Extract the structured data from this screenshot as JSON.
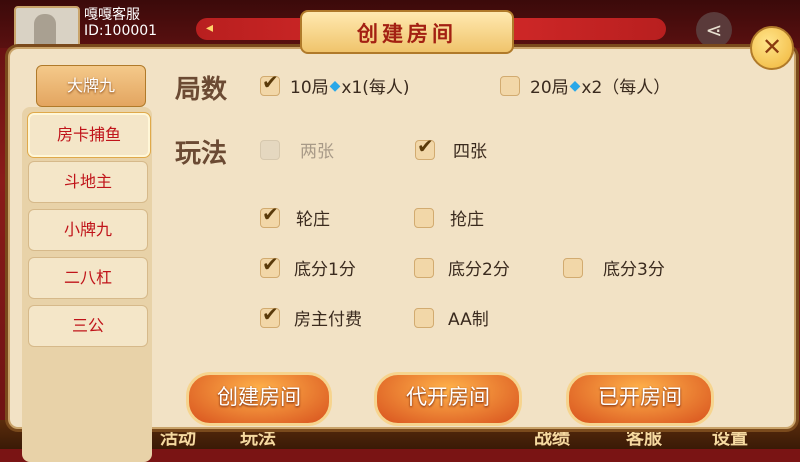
{
  "user": {
    "name": "嘎嘎客服",
    "id": "ID:100001"
  },
  "header": {
    "title": "创建房间"
  },
  "close_label": "✕",
  "sidebar": {
    "items": [
      {
        "label": "大牌九"
      },
      {
        "label": "房卡捕鱼"
      },
      {
        "label": "斗地主"
      },
      {
        "label": "小牌九"
      },
      {
        "label": "二八杠"
      },
      {
        "label": "三公"
      }
    ]
  },
  "rounds": {
    "label": "局数",
    "options": [
      {
        "label": "10局",
        "suffix": "x1(每人)",
        "checked": true
      },
      {
        "label": "20局",
        "suffix": "x2（每人）",
        "checked": false
      }
    ]
  },
  "play": {
    "label": "玩法",
    "options": [
      {
        "label": "两张",
        "checked": false,
        "disabled": true
      },
      {
        "label": "四张",
        "checked": true
      }
    ]
  },
  "banker": {
    "options": [
      {
        "label": "轮庄",
        "checked": true
      },
      {
        "label": "抢庄",
        "checked": false
      }
    ]
  },
  "score": {
    "options": [
      {
        "label": "底分1分",
        "checked": true
      },
      {
        "label": "底分2分",
        "checked": false
      },
      {
        "label": "底分3分",
        "checked": false
      }
    ]
  },
  "payment": {
    "options": [
      {
        "label": "房主付费",
        "checked": true
      },
      {
        "label": "AA制",
        "checked": false
      }
    ]
  },
  "buttons": {
    "create": "创建房间",
    "proxy": "代开房间",
    "opened": "已开房间"
  },
  "bottom_nav": [
    "活动",
    "玩法",
    "战绩",
    "客服",
    "设置"
  ],
  "colors": {
    "accent": "#c0141a",
    "button": "#d8521e",
    "panel": "#f2e2c5"
  }
}
